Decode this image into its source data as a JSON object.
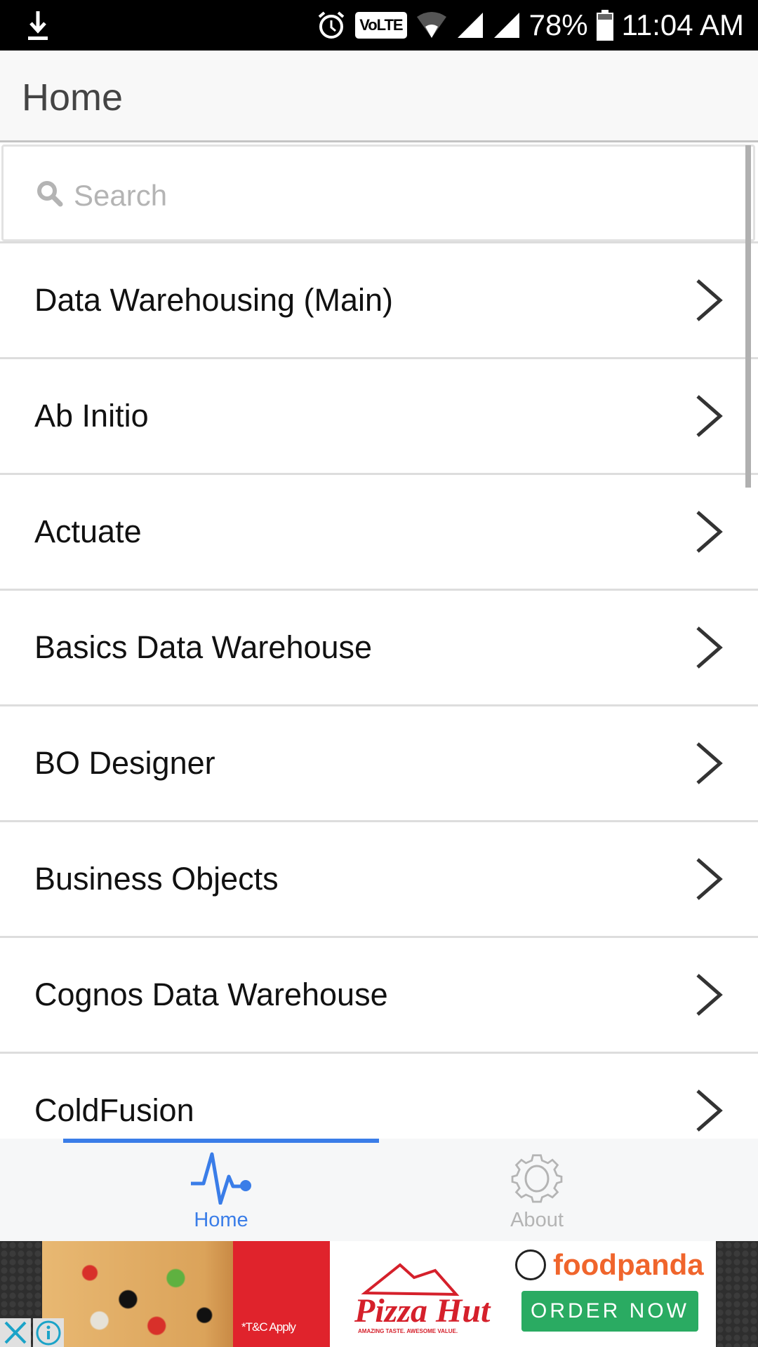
{
  "status_bar": {
    "download_icon": "download-arrow-icon",
    "alarm_icon": "alarm-clock-icon",
    "volte": "VoLTE",
    "battery_percent": "78%",
    "time": "11:04 AM"
  },
  "header": {
    "title": "Home"
  },
  "search": {
    "placeholder": "Search",
    "value": ""
  },
  "list": {
    "items": [
      {
        "label": "Data Warehousing (Main)"
      },
      {
        "label": "Ab Initio"
      },
      {
        "label": "Actuate"
      },
      {
        "label": "Basics Data Warehouse"
      },
      {
        "label": "BO Designer"
      },
      {
        "label": "Business Objects"
      },
      {
        "label": "Cognos Data Warehouse"
      },
      {
        "label": "ColdFusion"
      }
    ]
  },
  "tabs": {
    "home": {
      "label": "Home",
      "icon": "pulse-icon",
      "active": true
    },
    "about": {
      "label": "About",
      "icon": "gear-icon",
      "active": false
    }
  },
  "ad": {
    "tc_text": "*T&C Apply",
    "brand1": "Pizza Hut",
    "brand1_tagline": "AMAZING TASTE. AWESOME VALUE.",
    "brand2": "foodpanda",
    "cta": "ORDER NOW"
  },
  "colors": {
    "accent": "#3a7de8",
    "inactive": "#b4b4b4",
    "order_button": "#2aab62",
    "foodpanda": "#f0652c",
    "pizzahut_red": "#d5202b"
  }
}
